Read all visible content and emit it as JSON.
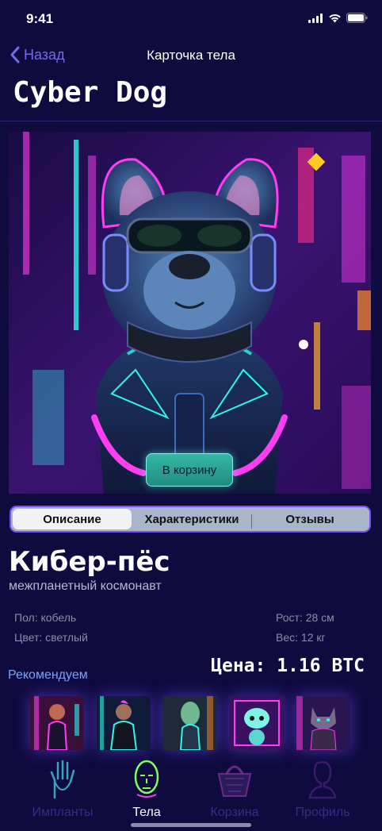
{
  "status": {
    "time": "9:41"
  },
  "nav": {
    "back_label": "Назад",
    "title": "Карточка тела"
  },
  "page_title": "Cyber Dog",
  "hero": {
    "image": "cyber-dog-neon-illustration",
    "cart_button": "В корзину"
  },
  "tabs": [
    {
      "label": "Описание",
      "active": true
    },
    {
      "label": "Характеристики",
      "active": false
    },
    {
      "label": "Отзывы",
      "active": false
    }
  ],
  "product": {
    "name": "Кибер-пёс",
    "subtitle": "межпланетный космонавт",
    "gender": "Пол: кобель",
    "color": "Цвет: светлый",
    "height": "Рост: 28 см",
    "weight": "Вес: 12 кг",
    "price": "Цена: 1.16 BTC"
  },
  "recommend": {
    "label": "Рекомендуем",
    "items": [
      "cyber-woman",
      "cyber-man",
      "alien-woman",
      "alien-creature",
      "cyber-cat"
    ]
  },
  "tabbar": [
    {
      "label": "Импланты",
      "icon": "hand-implant-icon",
      "active": false
    },
    {
      "label": "Тела",
      "icon": "head-icon",
      "active": true
    },
    {
      "label": "Корзина",
      "icon": "basket-icon",
      "active": false
    },
    {
      "label": "Профиль",
      "icon": "profile-icon",
      "active": false
    }
  ],
  "colors": {
    "background": "#0f0b3f",
    "accent": "#6f6de8",
    "neon_pink": "#ff3df2",
    "neon_cyan": "#2ff5e8"
  }
}
